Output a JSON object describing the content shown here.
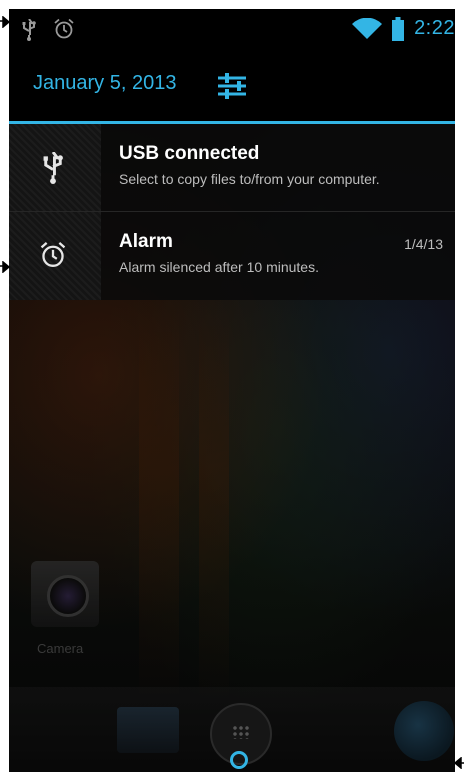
{
  "status_bar": {
    "left_icons": [
      "usb-icon",
      "alarm-icon"
    ],
    "right_icons": [
      "wifi-icon",
      "battery-icon"
    ],
    "time": "2:22"
  },
  "header": {
    "date": "January 5, 2013",
    "settings_icon": "quick-settings-icon"
  },
  "notifications": [
    {
      "icon": "usb-icon",
      "title": "USB connected",
      "text": "Select to copy files to/from your computer.",
      "time": ""
    },
    {
      "icon": "alarm-icon",
      "title": "Alarm",
      "text": "Alarm silenced after 10 minutes.",
      "time": "1/4/13"
    }
  ],
  "home": {
    "camera_label": "Camera"
  },
  "colors": {
    "accent": "#33b5e5",
    "background": "#000000"
  }
}
